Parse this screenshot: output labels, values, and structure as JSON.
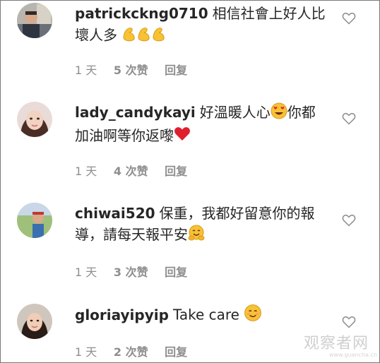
{
  "comments": [
    {
      "username": "patrickckng0710",
      "text": "相信社會上好人比壞人多",
      "emoji": [
        "flexed-biceps",
        "flexed-biceps",
        "flexed-biceps"
      ],
      "time": "1 天",
      "likes": "5 次赞",
      "reply": "回复"
    },
    {
      "username": "lady_candykayi",
      "text_part1": "好溫暖人心",
      "text_part2": "你都加油啊等你返嚟",
      "time": "1 天",
      "likes": "4 次赞",
      "reply": "回复"
    },
    {
      "username": "chiwai520",
      "text": "保重，我都好留意你的報導，請每天報平安",
      "time": "1 天",
      "likes": "3 次赞",
      "reply": "回复"
    },
    {
      "username": "gloriayipyip",
      "text": "Take care",
      "time": "1 天",
      "likes": "2 次赞",
      "reply": "回复"
    }
  ],
  "watermark": {
    "main": "观察者网",
    "sub": "www.guancha.cn"
  },
  "colors": {
    "text": "#262626",
    "meta": "#8e8e8e",
    "heart_stroke": "#8e8e8e"
  }
}
